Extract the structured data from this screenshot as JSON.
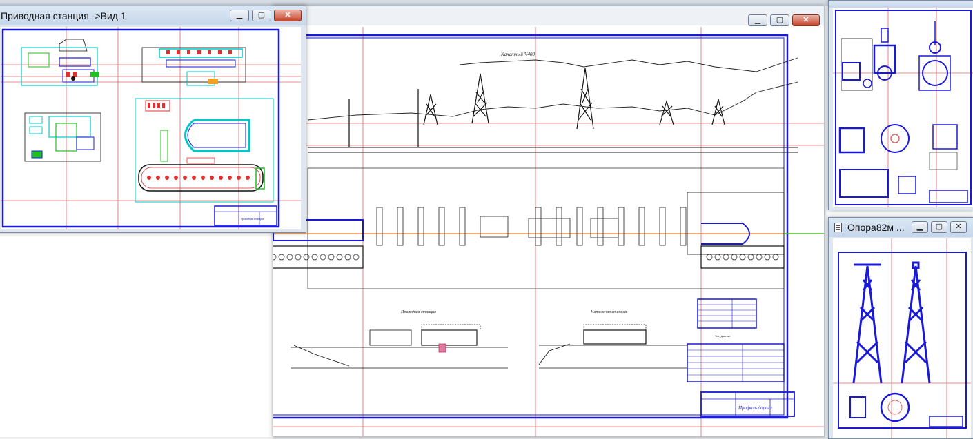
{
  "windows": {
    "drive_station": {
      "title": "Приводная станция ->Вид 1"
    },
    "main_drawing": {
      "title": ""
    },
    "right_top": {
      "title": ""
    },
    "support": {
      "title": "Опора82м ..."
    }
  },
  "window_buttons": {
    "minimize": "▁",
    "restore": "▢",
    "close": "✕"
  },
  "drawing": {
    "profile_title": "Канатный Ч400",
    "station_drive_label": "Приводная станция",
    "station_tension_label": "Натяжная станция",
    "tech_table_title": "Тех. данные",
    "stamp_title": "Профиль дороги",
    "left_drive_label": "Приводная станция"
  },
  "colors": {
    "frame_blue": "#1515d0",
    "red_grid": "#e05050",
    "cyan": "#00c8c8",
    "orange_axis": "#f28020",
    "green": "#20c020"
  }
}
